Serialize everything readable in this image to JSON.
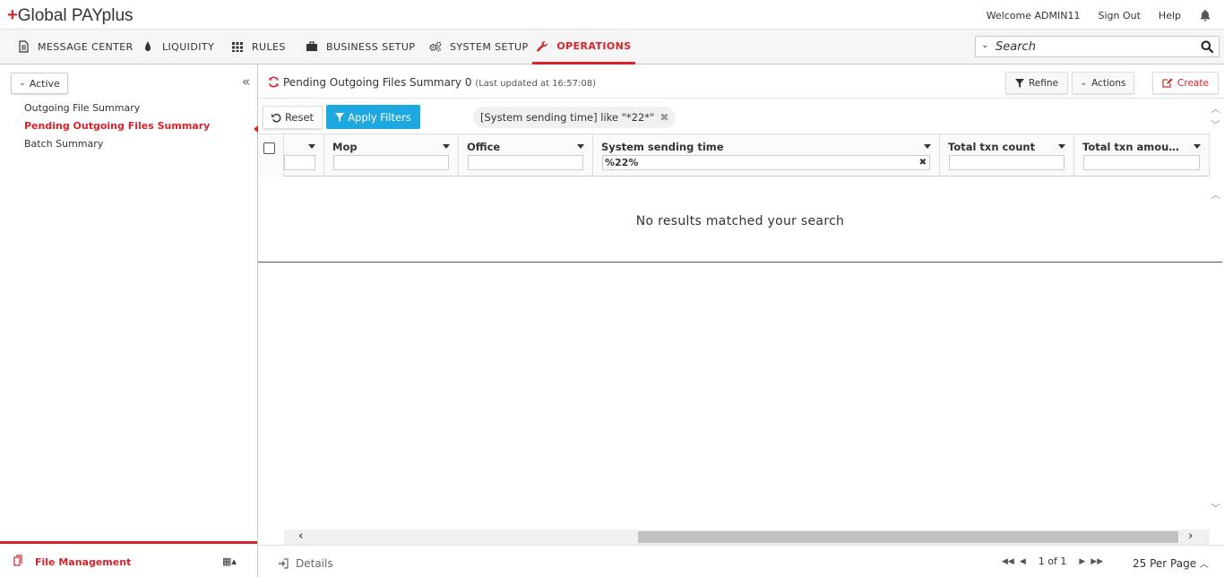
{
  "app": {
    "logo_plus": "+",
    "logo_text": "Global PAYplus"
  },
  "toplinks": {
    "welcome": "Welcome ADMIN11",
    "signout": "Sign Out",
    "help": "Help"
  },
  "nav": {
    "items": [
      {
        "label": "MESSAGE CENTER",
        "icon": "document-icon"
      },
      {
        "label": "LIQUIDITY",
        "icon": "drop-icon"
      },
      {
        "label": "RULES",
        "icon": "grid-icon"
      },
      {
        "label": "BUSINESS SETUP",
        "icon": "briefcase-icon"
      },
      {
        "label": "SYSTEM SETUP",
        "icon": "gears-icon"
      },
      {
        "label": "OPERATIONS",
        "icon": "wrench-icon"
      }
    ],
    "active": "OPERATIONS"
  },
  "search": {
    "placeholder": "Search",
    "value": ""
  },
  "left": {
    "active_button": "Active",
    "items": [
      "Outgoing File Summary",
      "Pending Outgoing Files Summary",
      "Batch Summary"
    ],
    "selected": "Pending Outgoing Files Summary",
    "footer_label": "File Management"
  },
  "page": {
    "title": "Pending Outgoing Files Summary 0",
    "updated": "(Last updated at 16:57:08)",
    "buttons": {
      "refine": "Refine",
      "actions": "Actions",
      "create": "Create"
    }
  },
  "filters": {
    "reset": "Reset",
    "apply": "Apply Filters",
    "chip": "[System sending time] like \"*22*\""
  },
  "grid": {
    "columns": [
      {
        "label": "",
        "filter": ""
      },
      {
        "label": "Mop",
        "filter": ""
      },
      {
        "label": "Office",
        "filter": ""
      },
      {
        "label": "System sending time",
        "filter": "%22%"
      },
      {
        "label": "Total txn count",
        "filter": ""
      },
      {
        "label": "Total txn amou…",
        "filter": ""
      }
    ],
    "empty_message": "No results matched your search"
  },
  "footer": {
    "details": "Details",
    "page_info": "1 of 1",
    "per_page": "25 Per Page"
  },
  "colors": {
    "accent": "#d8232a",
    "apply": "#1ea8e0"
  }
}
